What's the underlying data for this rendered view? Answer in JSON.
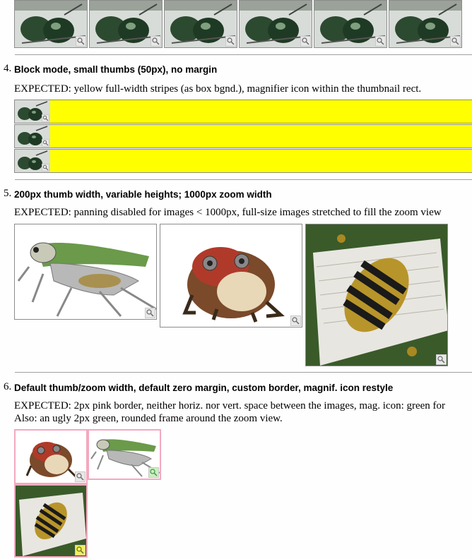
{
  "colors": {
    "yellow_stripe": "#ffff00",
    "pink_border": "#f4a8c0",
    "green_mag": "#c8f0c0",
    "yellow_mag": "#f0f060",
    "rule": "#a0a0a0"
  },
  "icons": {
    "magnifier": "magnifier-icon"
  },
  "top_strip": {
    "thumbnails": [
      "beetle",
      "beetle",
      "beetle",
      "beetle",
      "beetle",
      "beetle"
    ]
  },
  "sections": [
    {
      "number": "4.",
      "heading": "Block mode, small thumbs (50px), no margin",
      "expected": "EXPECTED: yellow full-width stripes (as box bgnd.), magnifier icon within the thumbnail rect."
    },
    {
      "number": "5.",
      "heading": "200px thumb width, variable heights; 1000px zoom width",
      "expected": "EXPECTED: panning disabled for images < 1000px, full-size images stretched to fill the zoom view"
    },
    {
      "number": "6.",
      "heading": "Default thumb/zoom width, default zero margin, custom border, magnif. icon restyle",
      "expected": "EXPECTED: 2px pink border, neither horiz. nor vert. space between the images, mag. icon: green for",
      "expected_line2": "Also: an ugly 2px green, rounded frame around the zoom view."
    }
  ]
}
